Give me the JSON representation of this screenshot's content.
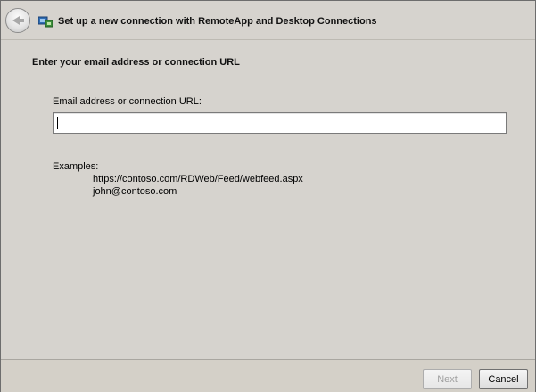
{
  "window": {
    "title": "Set up a new connection with RemoteApp and Desktop Connections",
    "back_icon": "back-arrow-icon",
    "app_icon": "remoteapp-icon"
  },
  "main": {
    "heading": "Enter your email address or connection URL",
    "field_label": "Email address or connection URL:",
    "field_value": "",
    "examples_label": "Examples:",
    "examples": [
      "https://contoso.com/RDWeb/Feed/webfeed.aspx",
      "john@contoso.com"
    ]
  },
  "footer": {
    "next_label": "Next",
    "cancel_label": "Cancel"
  }
}
